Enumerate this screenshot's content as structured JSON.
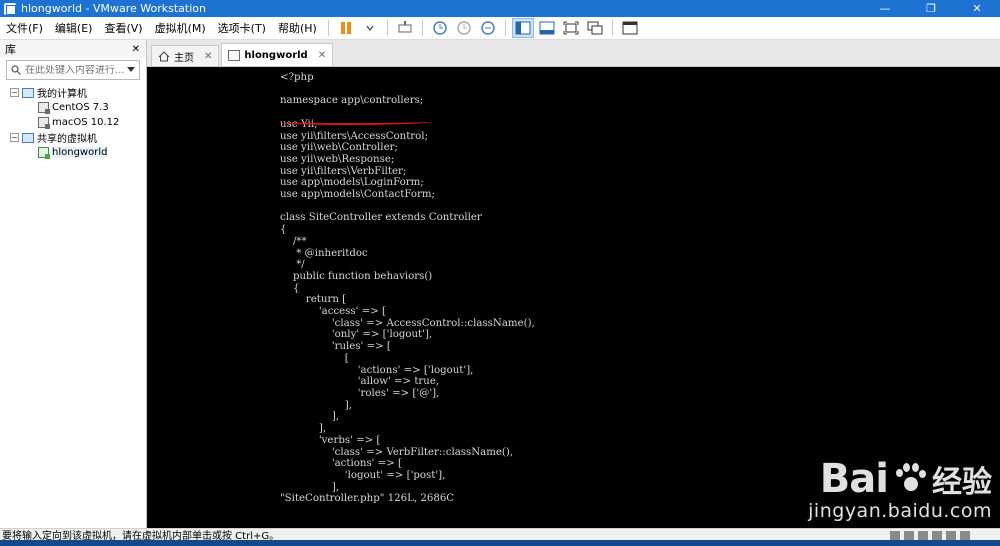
{
  "window": {
    "title": "hlongworld - VMware Workstation"
  },
  "menubar": {
    "items": [
      "文件(F)",
      "编辑(E)",
      "查看(V)",
      "虚拟机(M)",
      "选项卡(T)",
      "帮助(H)"
    ]
  },
  "library": {
    "title": "库",
    "close": "✕",
    "search_placeholder": "在此处键入内容进行...",
    "tree": {
      "my_computer": "我的计算机",
      "vm1": "CentOS 7.3",
      "vm2": "macOS 10.12",
      "shared": "共享的虚拟机",
      "vm3": "hlongworld"
    }
  },
  "tabs": [
    {
      "label": "主页",
      "close": "✕"
    },
    {
      "label": "hlongworld",
      "close": "✕"
    }
  ],
  "console": {
    "code": "<?php\n\nnamespace app\\controllers;\n\nuse Yii;\nuse yii\\filters\\AccessControl;\nuse yii\\web\\Controller;\nuse yii\\web\\Response;\nuse yii\\filters\\VerbFilter;\nuse app\\models\\LoginForm;\nuse app\\models\\ContactForm;\n\nclass SiteController extends Controller\n{\n    /**\n     * @inheritdoc\n     */\n    public function behaviors()\n    {\n        return [\n            'access' => [\n                'class' => AccessControl::className(),\n                'only' => ['logout'],\n                'rules' => [\n                    [\n                        'actions' => ['logout'],\n                        'allow' => true,\n                        'roles' => ['@'],\n                    ],\n                ],\n            ],\n            'verbs' => [\n                'class' => VerbFilter::className(),\n                'actions' => [\n                    'logout' => ['post'],\n                ],\n\"SiteController.php\" 126L, 2686C"
  },
  "watermark": {
    "logo_left": "Bai",
    "logo_right": "经验",
    "url": "jingyan.baidu.com"
  },
  "statusbar": {
    "text": "要将输入定向到该虚拟机，请在虚拟机内部单击或按 Ctrl+G。"
  }
}
